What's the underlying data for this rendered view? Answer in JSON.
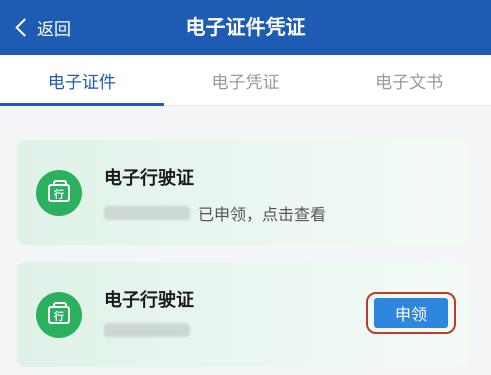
{
  "header": {
    "back_label": "返回",
    "title": "电子证件凭证"
  },
  "tabs": [
    {
      "label": "电子证件",
      "active": true
    },
    {
      "label": "电子凭证",
      "active": false
    },
    {
      "label": "电子文书",
      "active": false
    }
  ],
  "cards": [
    {
      "icon_char": "行",
      "title": "电子行驶证",
      "status": "已申领，点击查看"
    },
    {
      "icon_char": "行",
      "title": "电子行驶证",
      "action_label": "申领"
    }
  ],
  "colors": {
    "header_bg": "#1e5bb3",
    "accent": "#1e5bb3",
    "badge_green": "#2bb05f",
    "button_blue": "#2e86de",
    "highlight_red": "#c0392b"
  }
}
